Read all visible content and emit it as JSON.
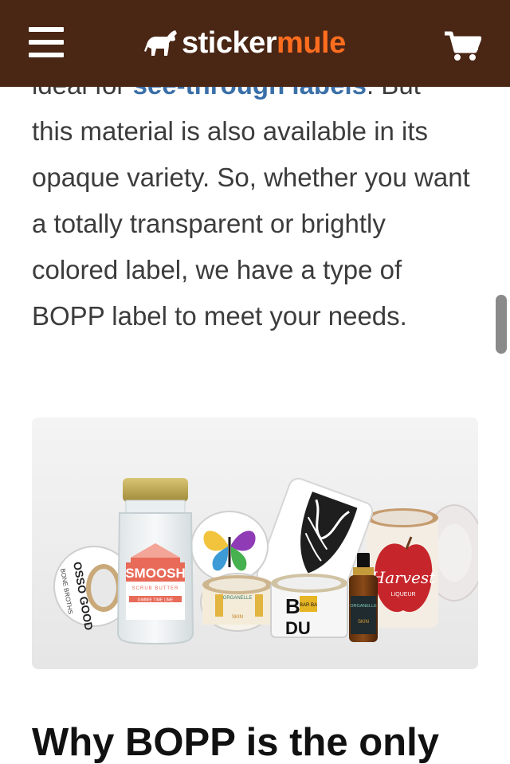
{
  "header": {
    "background": "#4a2615",
    "logo_part1": "sticker",
    "logo_part2": "mule",
    "logo_accent": "#ff6d1f",
    "menu_icon": "hamburger-menu-icon",
    "cart_icon": "shopping-cart-icon"
  },
  "article": {
    "cut_line_prefix": "ideal for ",
    "link_text": "see-through labels",
    "cut_line_suffix": ". But",
    "paragraph_rest": "this material is also available in its opaque variety. So, whether you want a totally transparent or brightly colored label, we have a type of BOPP label to meet your needs.",
    "heading": "Why BOPP is the only"
  },
  "photo": {
    "jar_label_brand": "SMOOSH",
    "jar_label_sub": "SCRUB BUTTER",
    "jar_label_line": "GIMMIE TIME LIME",
    "roll_left_text": "OSSO GOOD",
    "roll_left_sub": "BONE BROTHS",
    "roll_right_brand": "Harvest",
    "roll_right_sub": "LIQUEUR",
    "roll_dud_b": "B",
    "roll_dud_du": "DU",
    "roll_small_brand": "ORGANELLE",
    "roll_small_sub": "SKIN",
    "bottle_label": "ORGANELLE",
    "bottle_sub": "SKIN",
    "barba_small": "BAR BA",
    "link_color": "#3a6fa8"
  }
}
